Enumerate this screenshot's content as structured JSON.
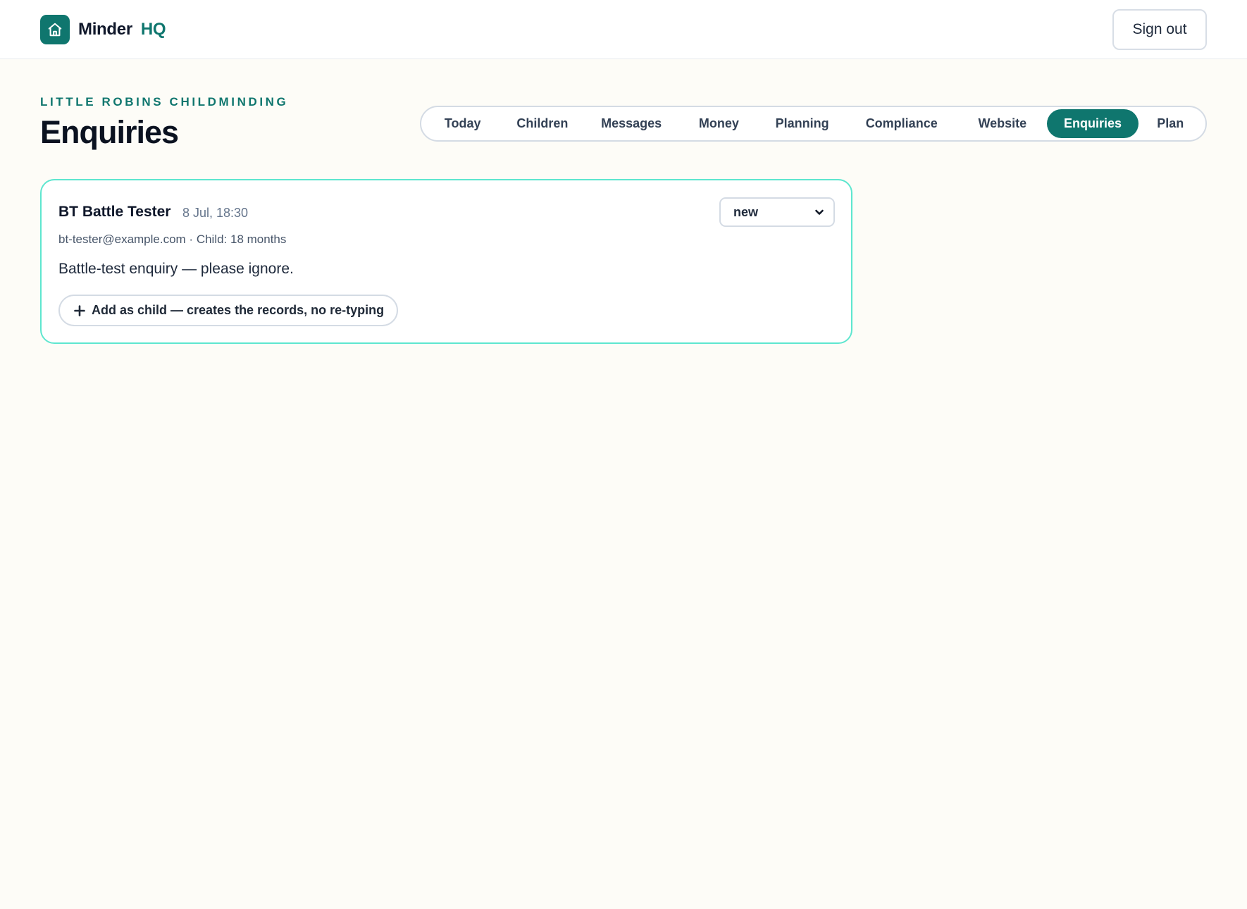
{
  "colors": {
    "accent": "#0f766e",
    "page_background": "#fdfcf7",
    "card_border": "#5ee6cf"
  },
  "header": {
    "brand_icon": "home-icon",
    "brand_name": "Minder",
    "brand_suffix": "HQ",
    "signout_label": "Sign out"
  },
  "page": {
    "eyebrow": "LITTLE ROBINS CHILDMINDING",
    "title": "Enquiries"
  },
  "nav": {
    "items": [
      {
        "label": "Today",
        "active": false
      },
      {
        "label": "Children",
        "active": false
      },
      {
        "label": "Messages",
        "active": false
      },
      {
        "label": "Money",
        "active": false
      },
      {
        "label": "Planning",
        "active": false
      },
      {
        "label": "Compliance",
        "active": false
      },
      {
        "label": "Website",
        "active": false
      },
      {
        "label": "Enquiries",
        "active": true
      },
      {
        "label": "Plan",
        "active": false
      }
    ]
  },
  "enquiries": [
    {
      "name": "BT Battle Tester",
      "time": "8 Jul, 18:30",
      "meta": "bt-tester@example.com · Child: 18 months",
      "message": "Battle-test enquiry — please ignore.",
      "status": "new",
      "status_icon": "chevron-down-icon",
      "action_icon": "plus-icon",
      "action_label": "Add as child — creates the records, no re-typing"
    }
  ]
}
